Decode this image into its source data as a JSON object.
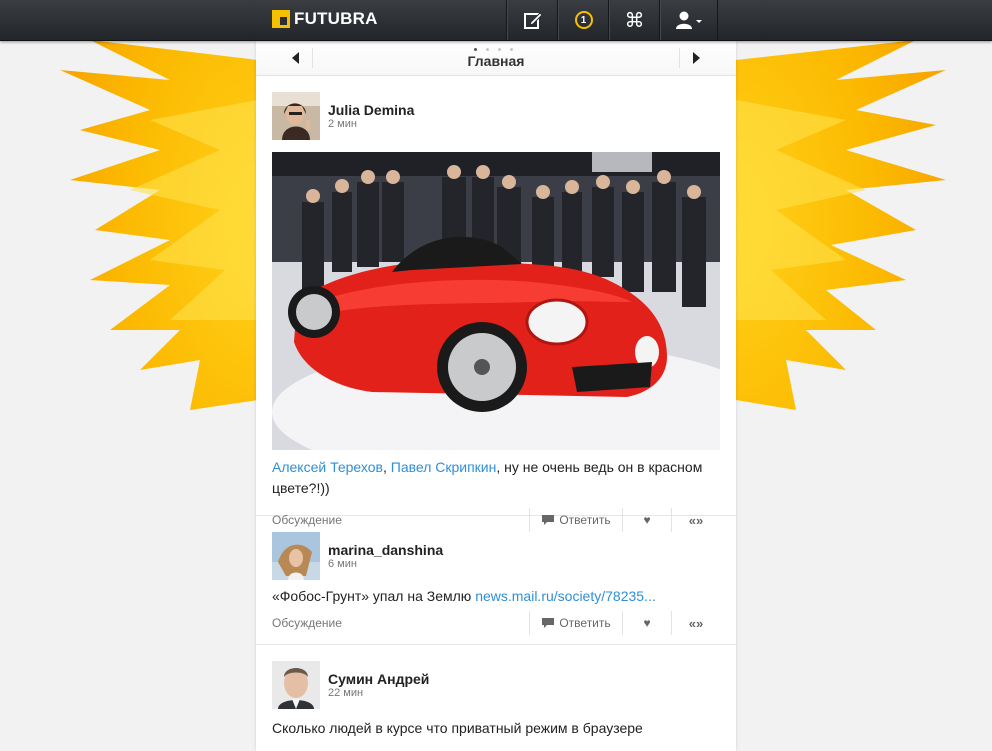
{
  "brand": {
    "name": "FUTUBRA",
    "accent": "#f4c000"
  },
  "topbar": {
    "icons": [
      "compose-icon",
      "notifications-icon",
      "command-icon",
      "user-menu-icon"
    ],
    "notification_count": "1"
  },
  "nav": {
    "title": "Главная",
    "page_dots": 4,
    "active_dot": 1
  },
  "posts": [
    {
      "author": "Julia Demina",
      "time": "2 мин",
      "mention1": "Алексей Терехов",
      "sep": ", ",
      "mention2": "Павел Скрипкин",
      "text": ", ну не очень ведь он в красном цвете?!))",
      "discussion": "Обсуждение",
      "reply": "Ответить"
    },
    {
      "author": "marina_danshina",
      "time": "6 мин",
      "text": "«Фобос-Грунт» упал на Землю ",
      "link": "news.mail.ru/society/78235...",
      "discussion": "Обсуждение",
      "reply": "Ответить"
    },
    {
      "author": "Сумин Андрей",
      "time": "22 мин",
      "text": "Сколько людей в курсе что приватный режим в браузере"
    }
  ]
}
